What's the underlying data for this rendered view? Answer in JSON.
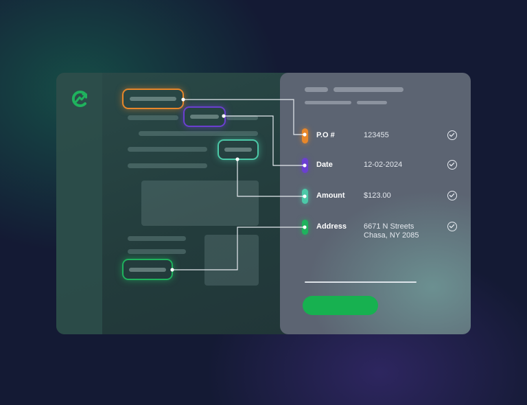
{
  "fields": [
    {
      "label": "P.O #",
      "value": "123455",
      "color": "#e8872a"
    },
    {
      "label": "Date",
      "value": "12-02-2024",
      "color": "#6b3fd1"
    },
    {
      "label": "Amount",
      "value": "$123.00",
      "color": "#4cc9a8"
    },
    {
      "label": "Address",
      "value": "6671 N Streets\nChasa, NY 2085",
      "color": "#1fb25d"
    }
  ],
  "submit_label": "",
  "colors": {
    "accent_green": "#17b150",
    "background": "#141a34",
    "panel": "#5c6472"
  },
  "icons": {
    "logo": "brand-logo-icon",
    "check": "check-circle-icon"
  }
}
